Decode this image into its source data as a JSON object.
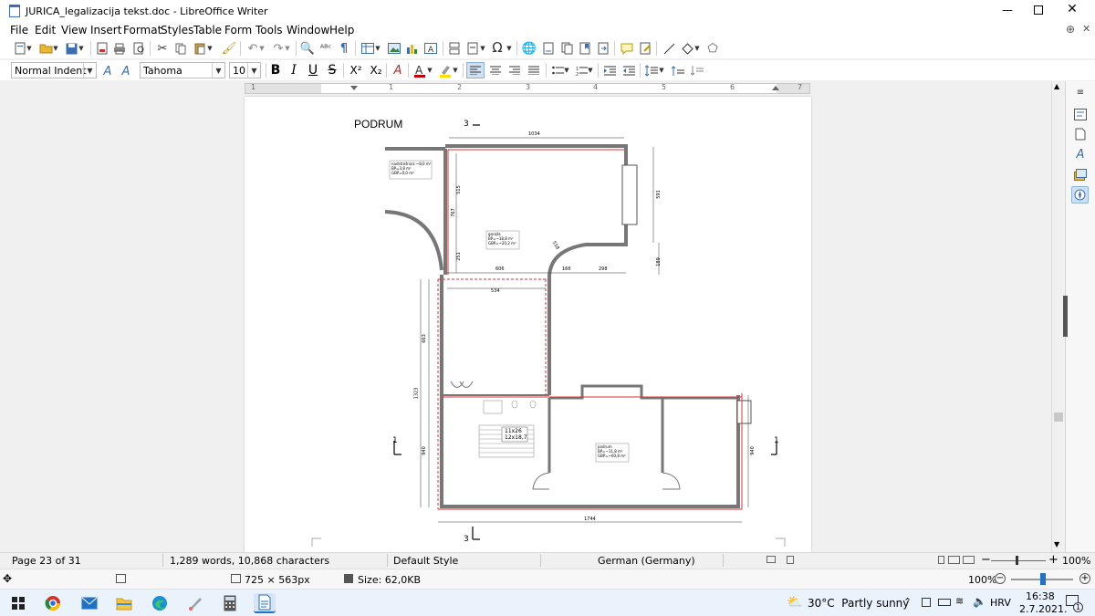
{
  "window": {
    "title": "JURICA_legalizacija  tekst.doc - LibreOffice Writer",
    "controls": [
      "minimize-icon",
      "maximize-icon",
      "close-icon"
    ]
  },
  "menu": [
    "File",
    "Edit",
    "View",
    "Insert",
    "Format",
    "Styles",
    "Table",
    "Form",
    "Tools",
    "Window",
    "Help"
  ],
  "formatting": {
    "paragraph_style": "Normal Indent",
    "font_name": "Tahoma",
    "font_size": "10",
    "bold": "B",
    "italic": "I",
    "underline": "U",
    "strike": "S",
    "superscript": "X²",
    "subscript": "X₂"
  },
  "ruler_ticks": [
    "1",
    "1",
    "2",
    "3",
    "4",
    "5",
    "6",
    "7"
  ],
  "drawing": {
    "heading": "PODRUM",
    "section_top": "3",
    "section_bottom": "3",
    "section_left": "1",
    "section_right": "1",
    "dims": {
      "top": "1034",
      "right_upper": "591",
      "inner_515": "515",
      "inner_767": "767",
      "inner_251": "251",
      "d606": "606",
      "d166": "166",
      "d298": "298",
      "d189": "189",
      "d534": "534",
      "d663": "663",
      "d1323": "1323",
      "d940_left": "940",
      "d940_right": "940",
      "bottom": "1744",
      "r518": "518"
    },
    "room1": [
      "nadstrešnica ~8,0 m²",
      "BP=3,8 m²",
      "GBP=0,0 m²"
    ],
    "room2": [
      "garaža",
      "BP=~18,8 m²",
      "GBP=~20,2 m²"
    ],
    "room3": [
      "podrum",
      "BP=~11,8 m²",
      "GBP=~60,8 m²"
    ],
    "stairs": [
      "11x26",
      "12x18,7"
    ]
  },
  "status": {
    "page": "Page 23 of 31",
    "words": "1,289 words, 10,868 characters",
    "style": "Default Style",
    "language": "German (Germany)",
    "zoom": "100%"
  },
  "viewer": {
    "dimensions": "725 × 563px",
    "size": "Size: 62,0KB",
    "zoom": "100%"
  },
  "taskbar": {
    "weather": "30°C  Partly sunny",
    "lang": "HRV",
    "time": "16:38",
    "date": "2.7.2021.",
    "notifications": "1"
  }
}
